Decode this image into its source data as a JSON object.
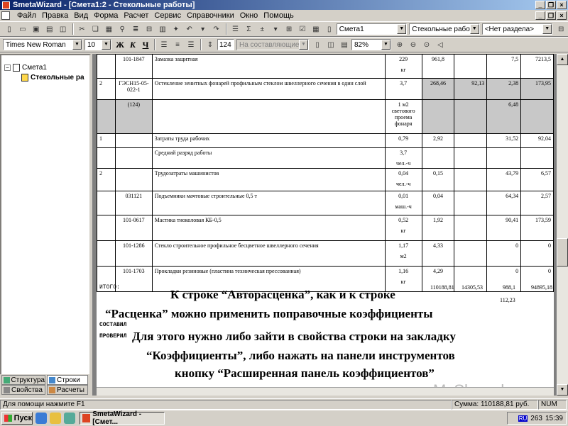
{
  "app": {
    "title": "SmetaWizard - [Смета1:2 - Стекольные работы]"
  },
  "menu": [
    "Файл",
    "Правка",
    "Вид",
    "Форма",
    "Расчет",
    "Сервис",
    "Справочники",
    "Окно",
    "Помощь"
  ],
  "toolbar": {
    "estimate_select": "Смета1",
    "section_select": "Стекольные работы",
    "subsection_select": "<Нет раздела>",
    "font_name": "Times New Roman",
    "font_size": "10",
    "bold_label": "Ж",
    "italic_label": "К",
    "underline_label": "Ч",
    "row_number": "124",
    "component_select": "На составляющие",
    "zoom": "82%"
  },
  "tree": {
    "root": "Смета1",
    "child": "Стекольные ра"
  },
  "left_tabs": {
    "structure": "Структура",
    "rows": "Строки",
    "properties": "Свойства",
    "calculations": "Расчеты"
  },
  "table": {
    "rows": [
      {
        "n": "",
        "code": "101-1847",
        "name": "Замазка защитная",
        "qty": "229",
        "unit": "кг",
        "c5": "961,8",
        "c6": "",
        "c7": "7,5",
        "c8": "7213,5"
      },
      {
        "n": "2",
        "code": "ГЭСН15-05-022-1",
        "name": "Остекление зенитных фонарей профильным стеклом швеллерного сечения в один слой",
        "qty": "3,7",
        "unit": "",
        "c5": "268,46",
        "c6": "92,13",
        "c7": "2,38",
        "c8": "173,95"
      },
      {
        "n": "",
        "code": "(124)",
        "name": "",
        "qty": "1 м2 светового проема фонаря",
        "unit": "",
        "c5": "",
        "c6": "",
        "c7": "6,48",
        "c8": ""
      },
      {
        "n": "1",
        "code": "",
        "name": "Затраты труда рабочих",
        "qty": "0,79",
        "unit": "",
        "c5": "2,92",
        "c6": "",
        "c7": "31,52",
        "c8": "92,04"
      },
      {
        "n": "",
        "code": "",
        "name": "Средний разряд работы",
        "qty": "3,7",
        "unit": "чел.-ч",
        "c5": "",
        "c6": "",
        "c7": "",
        "c8": ""
      },
      {
        "n": "2",
        "code": "",
        "name": "Трудозатраты машинистов",
        "qty": "0,04",
        "unit": "чел.-ч",
        "c5": "0,15",
        "c6": "",
        "c7": "43,79",
        "c8": "6,57"
      },
      {
        "n": "",
        "code": "031121",
        "name": "Подъемники мачтовые строительные 0,5 т",
        "qty": "0,01",
        "unit": "маш.-ч",
        "c5": "0,04",
        "c6": "",
        "c7": "64,34",
        "c8": "2,57"
      },
      {
        "n": "",
        "code": "101-0617",
        "name": "Мастика тиоколовая КБ-0,5",
        "qty": "0,52",
        "unit": "кг",
        "c5": "1,92",
        "c6": "",
        "c7": "90,41",
        "c8": "173,59"
      },
      {
        "n": "",
        "code": "101-1286",
        "name": "Стекло строительное профильное бесцветное швеллерного сечения",
        "qty": "1,17",
        "unit": "м2",
        "c5": "4,33",
        "c6": "",
        "c7": "0",
        "c8": "0"
      },
      {
        "n": "",
        "code": "101-1703",
        "name": "Прокладки резиновые (пластина техническая прессованная)",
        "qty": "1,16",
        "unit": "кг",
        "c5": "4,29",
        "c6": "",
        "c7": "0",
        "c8": "0"
      }
    ]
  },
  "totals": {
    "label": "ИТОГО:",
    "v1": "110188,81",
    "v2": "14305,53",
    "v3": "988,1",
    "v4": "94895,18",
    "v5": "112,23"
  },
  "signatures": {
    "composed": "СОСТАВИЛ",
    "checked": "ПРОВЕРИЛ"
  },
  "overlay": [
    "К строке “Авторасценка”, как и к строке",
    "“Расценка” можно применить поправочные коэффициенты",
    "Для этого нужно либо зайти в свойства строки на закладку",
    "“Коэффициенты”, либо нажать на панели инструментов",
    "кнопку “Расширенная панель коэффициентов”"
  ],
  "watermark": "MyShared",
  "status": {
    "help": "Для помощи нажмите F1",
    "sum": "Сумма: 110188,81 руб.",
    "mode": "NUM"
  },
  "taskbar": {
    "start": "Пуск",
    "task": "SmetaWizard - [Смет...",
    "lang": "RU",
    "time": "15:39",
    "counter": "263"
  }
}
